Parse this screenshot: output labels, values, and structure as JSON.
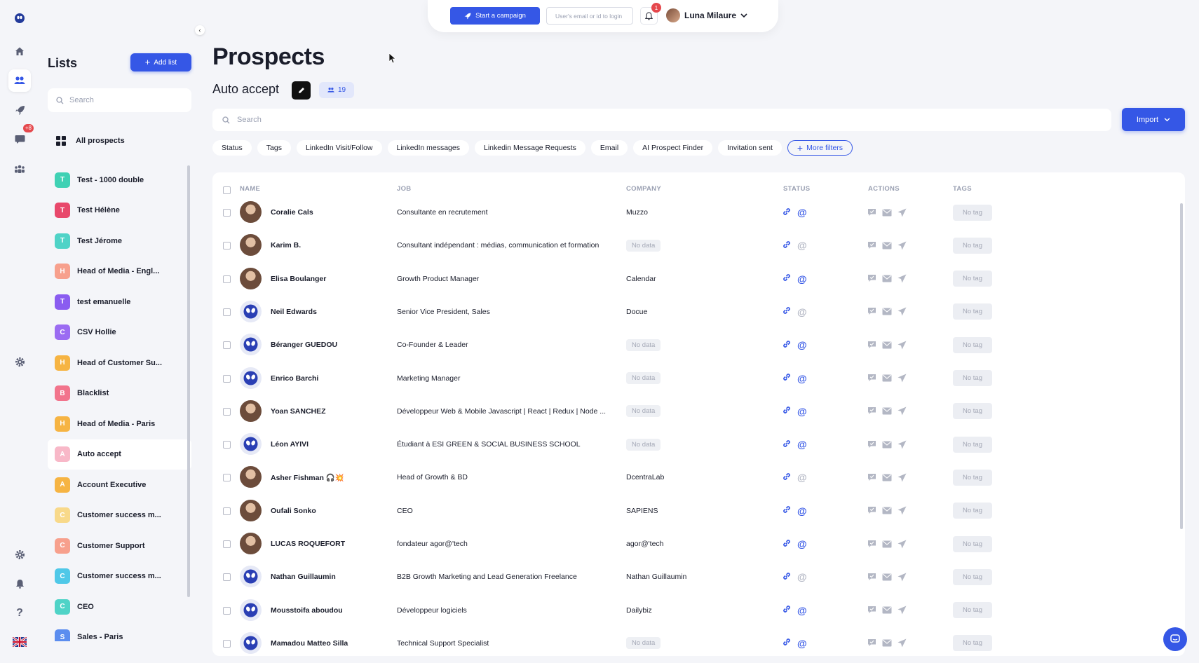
{
  "topbar": {
    "campaign_label": "Start a campaign",
    "user_search_placeholder": "User's email or id to login",
    "notif_count": "1",
    "user_name": "Luna Milaure"
  },
  "rail": {
    "messages_badge": "+8"
  },
  "lists_panel": {
    "title": "Lists",
    "add_label": "Add list",
    "search_placeholder": "Search",
    "all_label": "All prospects",
    "items": [
      {
        "letter": "T",
        "label": "Test - 1000 double",
        "color": "#3fd1b4"
      },
      {
        "letter": "T",
        "label": "Test Hélène",
        "color": "#e8486b"
      },
      {
        "letter": "T",
        "label": "Test Jérome",
        "color": "#4fd3c7"
      },
      {
        "letter": "H",
        "label": "Head of Media - Engl...",
        "color": "#f7a08d"
      },
      {
        "letter": "T",
        "label": "test emanuelle",
        "color": "#8a5cf0"
      },
      {
        "letter": "C",
        "label": "CSV Hollie",
        "color": "#9b6cf2"
      },
      {
        "letter": "H",
        "label": "Head of Customer Su...",
        "color": "#f6b443"
      },
      {
        "letter": "B",
        "label": "Blacklist",
        "color": "#f2748c"
      },
      {
        "letter": "H",
        "label": "Head of Media - Paris",
        "color": "#f6b443"
      },
      {
        "letter": "A",
        "label": "Auto accept",
        "color": "#f8b8c8"
      },
      {
        "letter": "A",
        "label": "Account Executive",
        "color": "#f6b443"
      },
      {
        "letter": "C",
        "label": "Customer success m...",
        "color": "#f8d98a"
      },
      {
        "letter": "C",
        "label": "Customer Support",
        "color": "#f7a08d"
      },
      {
        "letter": "C",
        "label": "Customer success m...",
        "color": "#4fc8e8"
      },
      {
        "letter": "C",
        "label": "CEO",
        "color": "#4fd3c7"
      },
      {
        "letter": "S",
        "label": "Sales - Paris",
        "color": "#5b8def"
      }
    ],
    "selected_index": 9
  },
  "page": {
    "title": "Prospects",
    "list_name": "Auto accept",
    "count": "19",
    "search_placeholder": "Search",
    "import_label": "Import"
  },
  "filters": [
    "Status",
    "Tags",
    "LinkedIn Visit/Follow",
    "LinkedIn messages",
    "Linkedin Message Requests",
    "Email",
    "AI Prospect Finder",
    "Invitation sent"
  ],
  "more_filters_label": "More filters",
  "table": {
    "headers": {
      "name": "NAME",
      "job": "JOB",
      "company": "COMPANY",
      "status": "STATUS",
      "actions": "ACTIONS",
      "tags": "TAGS"
    },
    "no_data": "No data",
    "no_tag": "No tag",
    "rows": [
      {
        "name": "Coralie Cals",
        "job": "Consultante en recrutement",
        "company": "Muzzo",
        "avatar": "photo",
        "email": true
      },
      {
        "name": "Karim B.",
        "job": "Consultant indépendant : médias, communication et formation",
        "company": "",
        "avatar": "photo",
        "email": false
      },
      {
        "name": "Elisa Boulanger",
        "job": "Growth Product Manager",
        "company": "Calendar",
        "avatar": "photo",
        "email": true
      },
      {
        "name": "Neil Edwards",
        "job": "Senior Vice President, Sales",
        "company": "Docue",
        "avatar": "alien",
        "email": false
      },
      {
        "name": "Béranger GUEDOU",
        "job": "Co-Founder & Leader",
        "company": "",
        "avatar": "alien",
        "email": true
      },
      {
        "name": "Enrico Barchi",
        "job": "Marketing Manager",
        "company": "",
        "avatar": "alien",
        "email": true
      },
      {
        "name": "Yoan SANCHEZ",
        "job": "Développeur Web & Mobile Javascript | React | Redux | Node ...",
        "company": "",
        "avatar": "photo",
        "email": true
      },
      {
        "name": "Léon AYIVI",
        "job": "Étudiant à ESI GREEN & SOCIAL BUSINESS SCHOOL",
        "company": "",
        "avatar": "alien",
        "email": true
      },
      {
        "name": "Asher Fishman 🎧💥",
        "job": "Head of Growth & BD",
        "company": "DcentraLab",
        "avatar": "photo",
        "email": false
      },
      {
        "name": "Oufali Sonko",
        "job": "CEO",
        "company": "SAPIENS",
        "avatar": "photo",
        "email": true
      },
      {
        "name": "LUCAS ROQUEFORT",
        "job": "fondateur agor@'tech",
        "company": "agor@'tech",
        "avatar": "photo",
        "email": true
      },
      {
        "name": "Nathan Guillaumin",
        "job": "B2B Growth Marketing and Lead Generation Freelance",
        "company": "Nathan Guillaumin",
        "avatar": "alien",
        "email": false
      },
      {
        "name": "Mousstoifa aboudou",
        "job": "Développeur logiciels",
        "company": "Dailybiz",
        "avatar": "alien",
        "email": true
      },
      {
        "name": "Mamadou Matteo Silla",
        "job": "Technical Support Specialist",
        "company": "",
        "avatar": "alien",
        "email": true
      }
    ]
  },
  "colors": {
    "accent": "#3557e6",
    "background": "#f4f5f9"
  }
}
